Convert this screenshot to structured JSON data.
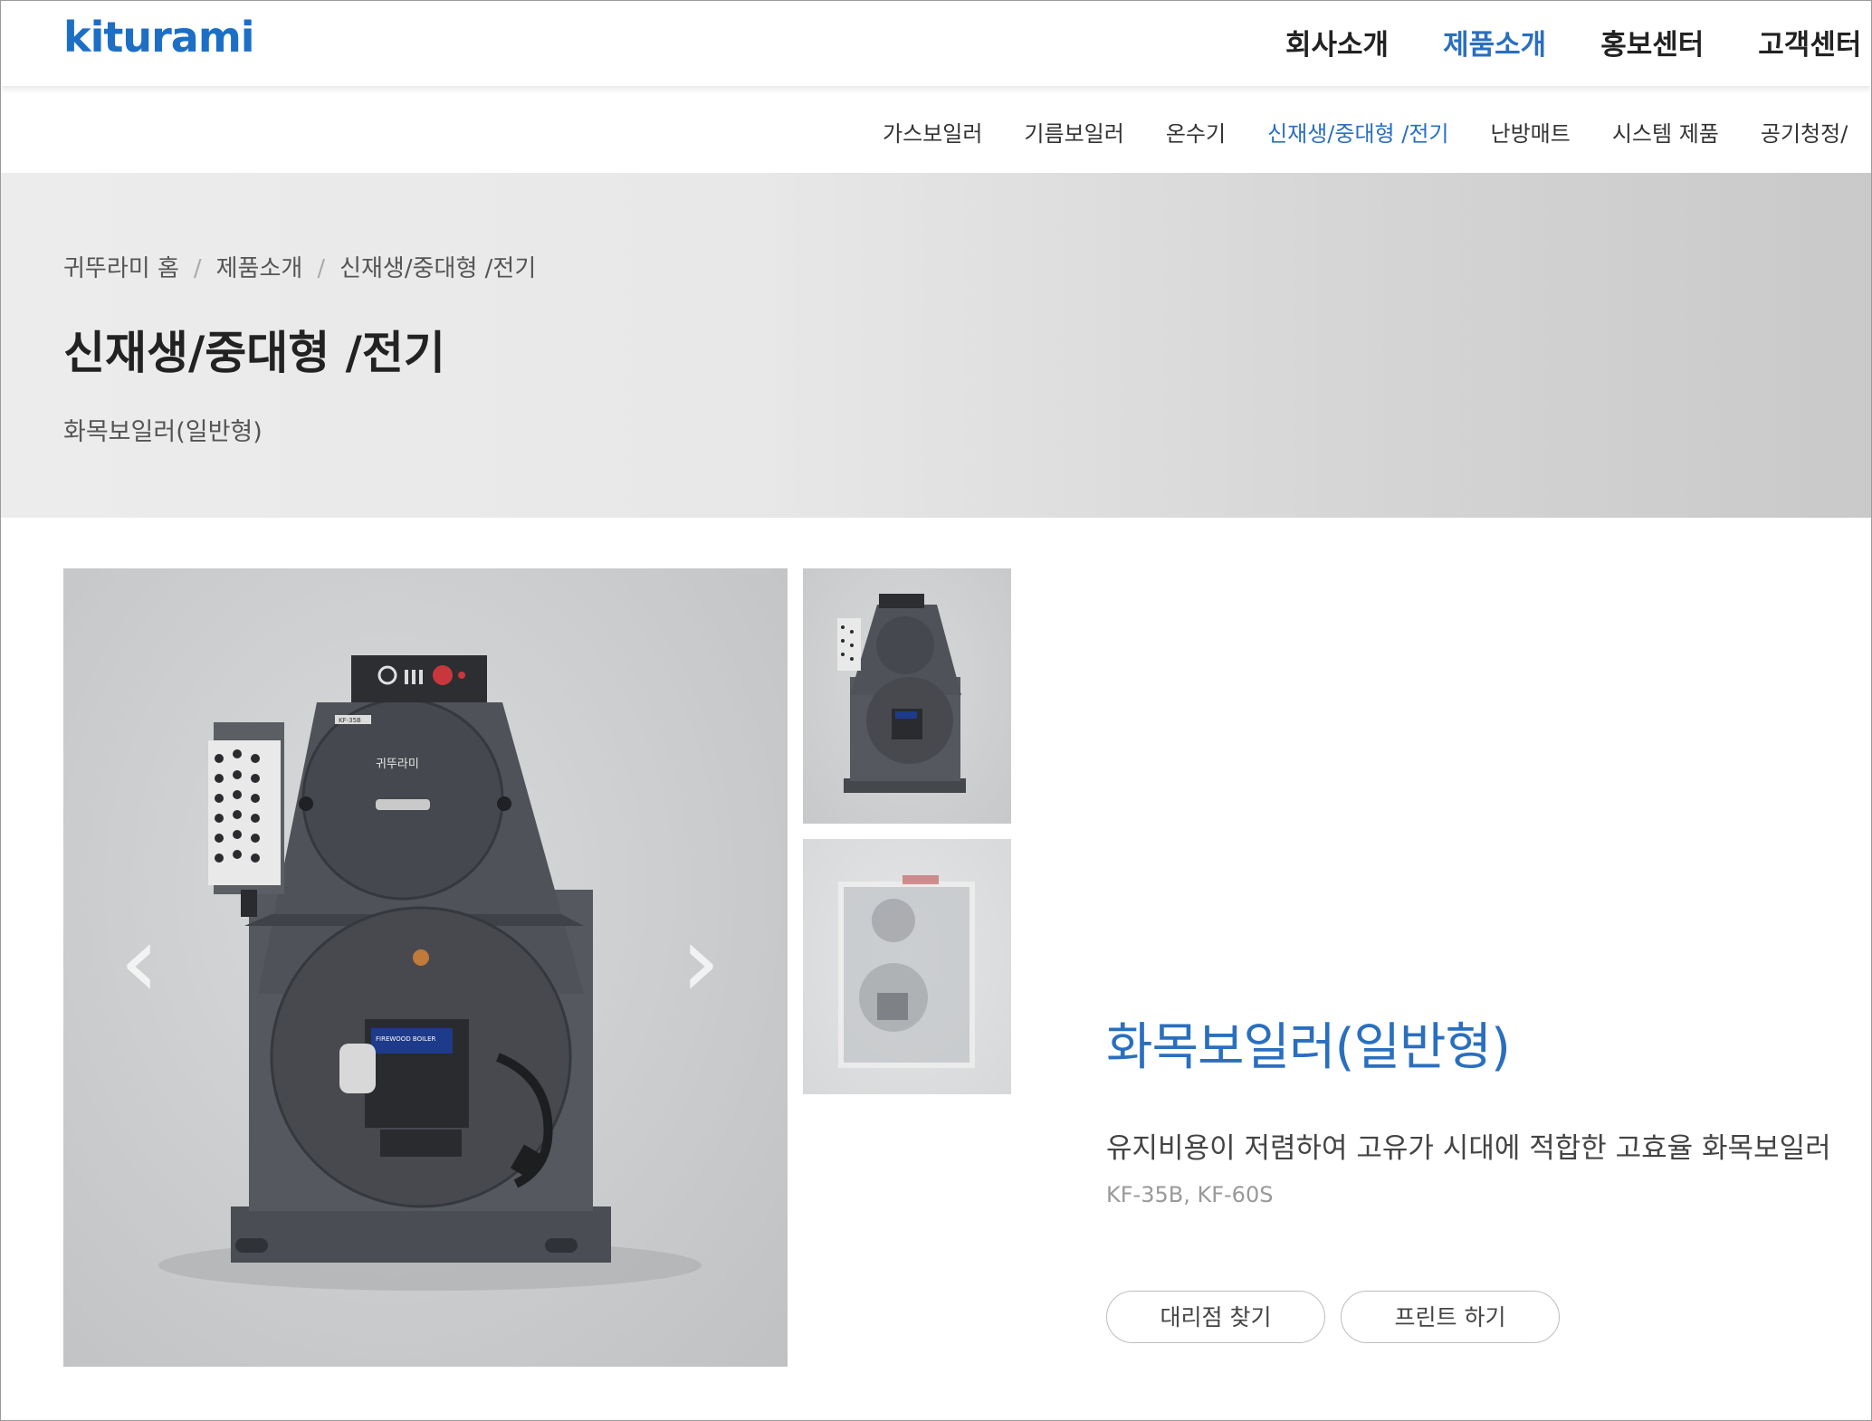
{
  "header": {
    "logo_text": "kiturami",
    "nav": [
      "회사소개",
      "제품소개",
      "홍보센터",
      "고객센터"
    ],
    "nav_active_index": 1
  },
  "subnav": {
    "items": [
      "가스보일러",
      "기름보일러",
      "온수기",
      "신재생/중대형 /전기",
      "난방매트",
      "시스템 제품",
      "공기청정/"
    ],
    "active_index": 3
  },
  "banner": {
    "breadcrumb": [
      "귀뚜라미 홈",
      "제품소개",
      "신재생/중대형 /전기"
    ],
    "title": "신재생/중대형 /전기",
    "subtitle": "화목보일러(일반형)"
  },
  "gallery": {
    "main_label_brand": "귀뚜라미",
    "main_label_panel": "FIREWOOD BOILER",
    "plate_text": "KF-35B"
  },
  "product": {
    "name": "화목보일러(일반형)",
    "description": "유지비용이 저렴하여 고유가 시대에 적합한 고효율 화목보일러",
    "models": "KF-35B, KF-60S",
    "dealer_button": "대리점 찾기",
    "print_button": "프린트 하기"
  },
  "colors": {
    "brand_blue": "#1d6fc5",
    "active_blue": "#2a6fbf",
    "boiler_body": "#4e5157"
  }
}
